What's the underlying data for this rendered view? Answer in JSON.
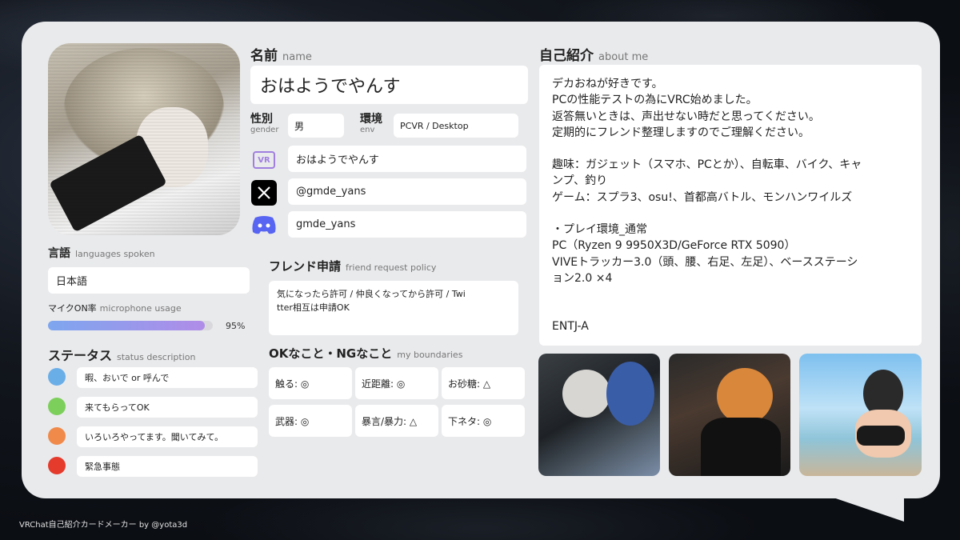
{
  "profile": {
    "name_label": "名前",
    "name_sub": "name",
    "name_value": "おはようでやんす",
    "gender_label": "性別",
    "gender_sub": "gender",
    "gender_value": "男",
    "env_label": "環境",
    "env_sub": "env",
    "env_value": "PCVR / Desktop",
    "vrc_name": "おはようでやんす",
    "x_handle": "@gmde_yans",
    "discord_handle": "gmde_yans",
    "vr_icon_text": "VR"
  },
  "languages": {
    "label": "言語",
    "sub": "languages spoken",
    "value": "日本語"
  },
  "mic": {
    "label": "マイクON率",
    "sub": "microphone usage",
    "percent_text": "95%",
    "percent": 95
  },
  "status": {
    "label": "ステータス",
    "sub": "status description",
    "items": [
      {
        "color": "#6aaee8",
        "text": "暇、おいで or 呼んで"
      },
      {
        "color": "#7dcf5c",
        "text": "来てもらってOK"
      },
      {
        "color": "#f08a4b",
        "text": "いろいろやってます。聞いてみて。"
      },
      {
        "color": "#e53b2c",
        "text": "緊急事態"
      }
    ]
  },
  "friend": {
    "label": "フレンド申請",
    "sub": "friend request policy",
    "text_line1": "気になったら許可 / 仲良くなってから許可 / Twi",
    "text_line2": "tter相互は申請OK"
  },
  "boundaries": {
    "label": "OKなこと・NGなこと",
    "sub": "my boundaries",
    "items": [
      "触る: ◎",
      "近距離: ◎",
      "お砂糖: △",
      "武器: ◎",
      "暴言/暴力: △",
      "下ネタ: ◎"
    ]
  },
  "about": {
    "label": "自己紹介",
    "sub": "about me",
    "lines": [
      "デカおねが好きです。",
      "PCの性能テストの為にVRC始めました。",
      "返答無いときは、声出せない時だと思ってください。",
      "定期的にフレンド整理しますのでご理解ください。",
      "",
      "趣味：ガジェット（スマホ、PCとか）、自転車、バイク、キャ",
      "ンプ、釣り",
      "ゲーム：スプラ3、osu!、首都高バトル、モンハンワイルズ",
      "",
      "・プレイ環境_通常",
      "PC（Ryzen 9 9950X3D/GeForce RTX 5090）",
      "VIVEトラッカー3.0（頭、腰、右足、左足）、ベースステーシ",
      "ョン2.0 ×4",
      "",
      "",
      "ENTJ-A"
    ]
  },
  "footer": "VRChat自己紹介カードメーカー by @yota3d"
}
